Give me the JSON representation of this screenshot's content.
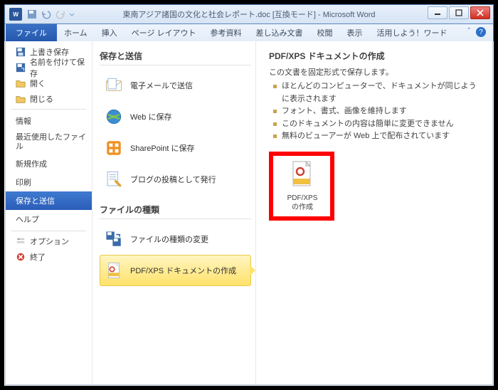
{
  "titlebar": {
    "title": "東南アジア諸国の文化と社会レポート.doc [互換モード] - Microsoft Word"
  },
  "tabs": {
    "file": "ファイル",
    "items": [
      "ホーム",
      "挿入",
      "ページ レイアウト",
      "参考資料",
      "差し込み文書",
      "校閲",
      "表示",
      "活用しよう！ワード"
    ]
  },
  "side": {
    "sec1": [
      {
        "label": "上書き保存",
        "icon": "save"
      },
      {
        "label": "名前を付けて保存",
        "icon": "saveas"
      },
      {
        "label": "開く",
        "icon": "open"
      },
      {
        "label": "閉じる",
        "icon": "close"
      }
    ],
    "sec2": [
      {
        "label": "情報"
      },
      {
        "label": "最近使用したファイル"
      },
      {
        "label": "新規作成"
      },
      {
        "label": "印刷"
      },
      {
        "label": "保存と送信",
        "active": true
      },
      {
        "label": "ヘルプ"
      }
    ],
    "sec3": [
      {
        "label": "オプション",
        "icon": "options"
      },
      {
        "label": "終了",
        "icon": "exit"
      }
    ]
  },
  "mid": {
    "h1": "保存と送信",
    "group1": [
      {
        "label": "電子メールで送信",
        "icon": "mail"
      },
      {
        "label": "Web に保存",
        "icon": "web"
      },
      {
        "label": "SharePoint に保存",
        "icon": "sharepoint"
      },
      {
        "label": "ブログの投稿として発行",
        "icon": "blog"
      }
    ],
    "h2": "ファイルの種類",
    "group2": [
      {
        "label": "ファイルの種類の変更",
        "icon": "changetype"
      },
      {
        "label": "PDF/XPS ドキュメントの作成",
        "icon": "pdf",
        "active": true
      }
    ]
  },
  "right": {
    "heading": "PDF/XPS ドキュメントの作成",
    "desc": "この文書を固定形式で保存します。",
    "bullets": [
      "ほとんどのコンピューターで、ドキュメントが同じように表示されます",
      "フォント、書式、画像を維持します",
      "このドキュメントの内容は簡単に変更できません",
      "無料のビューアーが Web 上で配布されています"
    ],
    "button": {
      "line1": "PDF/XPS",
      "line2": "の作成"
    }
  }
}
